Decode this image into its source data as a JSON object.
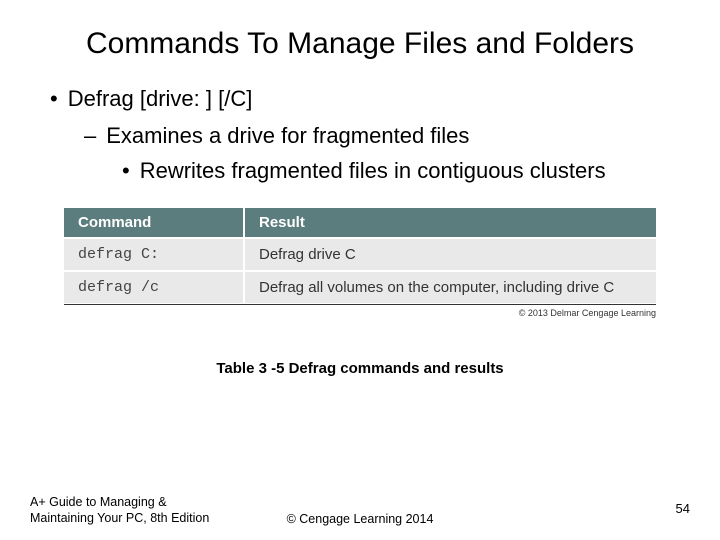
{
  "title": "Commands To Manage Files and Folders",
  "bullets": {
    "level1": "Defrag [drive: ] [/C]",
    "level2": "Examines a drive for fragmented files",
    "level3": "Rewrites fragmented files in contiguous clusters"
  },
  "table": {
    "headers": {
      "col1": "Command",
      "col2": "Result"
    },
    "rows": [
      {
        "command": "defrag C:",
        "result": "Defrag drive C"
      },
      {
        "command": "defrag /c",
        "result": "Defrag all volumes on the computer, including drive C"
      }
    ]
  },
  "table_copyright": "© 2013 Delmar Cengage Learning",
  "caption": "Table 3 -5 Defrag commands and results",
  "footer": {
    "book_line1": "A+ Guide to Managing &",
    "book_line2": "Maintaining Your PC, 8th Edition",
    "center": "© Cengage Learning  2014",
    "page": "54"
  },
  "chart_data": {
    "type": "table",
    "title": "Table 3-5 Defrag commands and results",
    "columns": [
      "Command",
      "Result"
    ],
    "rows": [
      [
        "defrag C:",
        "Defrag drive C"
      ],
      [
        "defrag /c",
        "Defrag all volumes on the computer, including drive C"
      ]
    ]
  }
}
